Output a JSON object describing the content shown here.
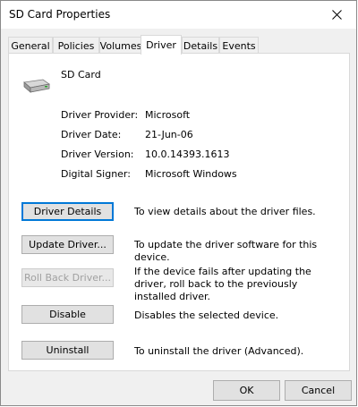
{
  "window": {
    "title": "SD Card Properties"
  },
  "tabs": [
    {
      "label": "General"
    },
    {
      "label": "Policies"
    },
    {
      "label": "Volumes"
    },
    {
      "label": "Driver"
    },
    {
      "label": "Details"
    },
    {
      "label": "Events"
    }
  ],
  "active_tab": "Driver",
  "device": {
    "name": "SD Card",
    "icon": "sd-card-drive-icon"
  },
  "info": [
    {
      "label": "Driver Provider:",
      "value": "Microsoft"
    },
    {
      "label": "Driver Date:",
      "value": "21-Jun-06"
    },
    {
      "label": "Driver Version:",
      "value": "10.0.14393.1613"
    },
    {
      "label": "Digital Signer:",
      "value": "Microsoft Windows"
    }
  ],
  "actions": [
    {
      "label": "Driver Details",
      "description": "To view details about the driver files.",
      "enabled": true
    },
    {
      "label": "Update Driver...",
      "description": "To update the driver software for this device.",
      "enabled": true
    },
    {
      "label": "Roll Back Driver...",
      "description": "If the device fails after updating the driver, roll back to the previously installed driver.",
      "enabled": false
    },
    {
      "label": "Disable",
      "description": "Disables the selected device.",
      "enabled": true
    },
    {
      "label": "Uninstall",
      "description": "To uninstall the driver (Advanced).",
      "enabled": true
    }
  ],
  "footer": {
    "ok_label": "OK",
    "cancel_label": "Cancel"
  },
  "colors": {
    "focus_border": "#0078d7",
    "window_bg": "#f0f0f0",
    "panel_bg": "#ffffff"
  }
}
